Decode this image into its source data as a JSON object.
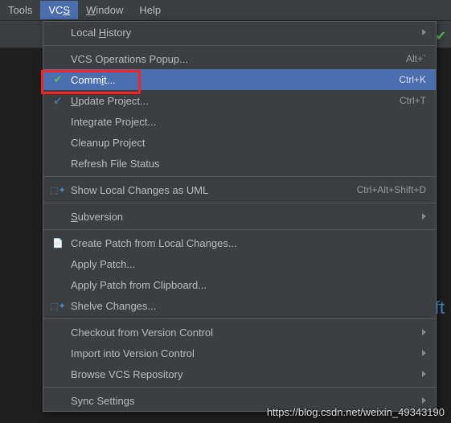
{
  "menubar": {
    "tools": "Tools",
    "vcs": "VCS",
    "window": "Window",
    "help": "Help"
  },
  "dropdown": {
    "local_history": "Local History",
    "vcs_ops_popup": "VCS Operations Popup...",
    "vcs_ops_shortcut": "Alt+`",
    "commit": "Commit...",
    "commit_shortcut": "Ctrl+K",
    "update_project": "Update Project...",
    "update_shortcut": "Ctrl+T",
    "integrate_project": "Integrate Project...",
    "cleanup_project": "Cleanup Project",
    "refresh_file_status": "Refresh File Status",
    "show_local_changes_uml": "Show Local Changes as UML",
    "show_uml_shortcut": "Ctrl+Alt+Shift+D",
    "subversion": "Subversion",
    "create_patch": "Create Patch from Local Changes...",
    "apply_patch": "Apply Patch...",
    "apply_patch_clipboard": "Apply Patch from Clipboard...",
    "shelve_changes": "Shelve Changes...",
    "checkout_vc": "Checkout from Version Control",
    "import_vc": "Import into Version Control",
    "browse_vcs_repo": "Browse VCS Repository",
    "sync_settings": "Sync Settings"
  },
  "bg_hint": "ift",
  "watermark": "https://blog.csdn.net/weixin_49343190"
}
